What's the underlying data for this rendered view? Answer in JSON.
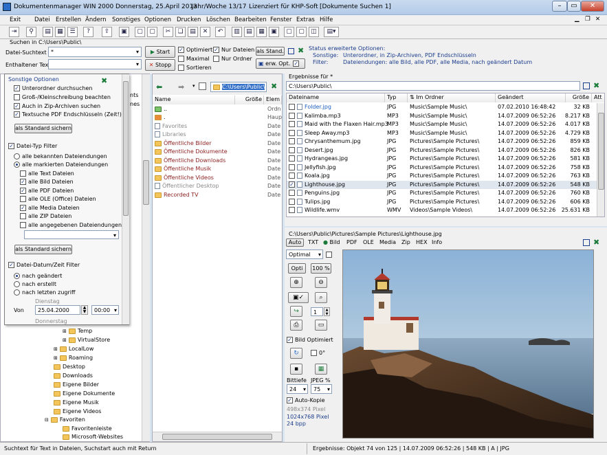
{
  "window": {
    "title": "Dokumentenmanager WIN 2000",
    "date": "Donnerstag, 25.April 2013",
    "week": "Jahr/Woche 13/17",
    "license": "Lizenziert für KHP-Soft",
    "doc": "[Dokumente Suchen 1]"
  },
  "menu": [
    "Exit",
    "Datei",
    "Erstellen",
    "Ändern",
    "Sonstiges",
    "Optionen",
    "Drucken",
    "Löschen",
    "Bearbeiten",
    "Fenster",
    "Extras",
    "Hilfe"
  ],
  "search": {
    "scope_label": "Suchen in C:\\Users\\Public\\",
    "file_label": "Datei-Suchtext",
    "file_value": "*",
    "content_label": "Enthaltener Text",
    "content_value": "",
    "start": "Start",
    "stop": "Stopp",
    "opt_optimiert": "Optimiert",
    "opt_maximal": "Maximal",
    "opt_sortieren": "Sortieren",
    "opt_nur_dateien": "Nur Dateien",
    "opt_nur_ordner": "Nur Ordner",
    "als_stand": "als Stand.",
    "erw_opt": "erw. Opt.",
    "status_title": "Status erweiterte Optionen:",
    "status_sonstige_k": "Sonstige:",
    "status_sonstige_v": "Unterordner, in Zip-Archiven, PDF Endschlüsseln",
    "status_filter_k": "Filter:",
    "status_filter_v": "Dateiendungen: alle Bild, alle PDF, alle Media, nach geändert Datum"
  },
  "options": {
    "title": "Sonstige Optionen",
    "items": [
      "Unterordner durchsuchen",
      "Groß-/Kleinschreibung beachten",
      "Auch in Zip-Archiven suchen",
      "Textsuche PDF Endschlüsseln (Zeit!)"
    ],
    "checked": [
      true,
      false,
      true,
      true
    ],
    "std_button": "als Standard sichern",
    "typ_title": "Datei-Typ Filter",
    "typ_radio": [
      "alle bekannten Dateiendungen",
      "alle markierten Dateiendungen"
    ],
    "typ_items": [
      "alle Text Dateien",
      "alle Bild Dateien",
      "alle PDF Dateien",
      "alle OLE (Office) Dateien",
      "alle Media Dateien",
      "alle ZIP Dateien",
      "alle angegebenen Dateiendungen"
    ],
    "typ_checked": [
      false,
      true,
      true,
      false,
      true,
      false,
      false
    ],
    "std_button2": "als Standard sichern",
    "date_title": "Datei-Datum/Zeit Filter",
    "date_radio": [
      "nach geändert",
      "nach erstellt",
      "nach letzten zugriff"
    ],
    "weekday": "Dienstag",
    "von_label": "Von",
    "von_date": "25.04.2000",
    "von_time": "00:00",
    "bis_weekday": "Donnerstag"
  },
  "tree_peek": [
    "nts",
    "nes"
  ],
  "tree": [
    "Temp",
    "VirtualStore",
    "LocalLow",
    "Roaming",
    "Desktop",
    "Downloads",
    "Eigene Bilder",
    "Eigene Dokumente",
    "Eigene Musik",
    "Eigene Videos",
    "Favoriten",
    "Favoritenleiste",
    "Microsoft-Websites"
  ],
  "browser": {
    "path": "C:\\Users\\Public\\",
    "cols": [
      "Name",
      "Größe",
      "Elem"
    ],
    "rows": [
      {
        "n": "..",
        "t": "Ordn"
      },
      {
        "n": ".",
        "t": "Haup"
      },
      {
        "n": "Favorites",
        "t": "Date"
      },
      {
        "n": "Libraries",
        "t": "Date"
      },
      {
        "n": "Öffentliche Bilder",
        "t": "Date"
      },
      {
        "n": "Öffentliche Dokumente",
        "t": "Date"
      },
      {
        "n": "Öffentliche Downloads",
        "t": "Date"
      },
      {
        "n": "Öffentliche Musik",
        "t": "Date"
      },
      {
        "n": "Öffentliche Videos",
        "t": "Date"
      },
      {
        "n": "Öffentlicher Desktop",
        "t": "Date"
      },
      {
        "n": "Recorded TV",
        "t": "Date"
      }
    ]
  },
  "results": {
    "label": "Ergebnisse für *",
    "path": "C:\\Users\\Public\\",
    "cols": [
      "Dateiname",
      "Typ",
      "Im Ordner",
      "Geändert",
      "Größe",
      "Att"
    ],
    "rows": [
      {
        "n": "Folder.jpg",
        "t": "JPG",
        "o": "Music\\Sample Music\\",
        "g": "07.02.2010 16:48:42",
        "s": "32 KB",
        "c": false
      },
      {
        "n": "Kalimba.mp3",
        "t": "MP3",
        "o": "Music\\Sample Music\\",
        "g": "14.07.2009 06:52:26",
        "s": "8.217 KB",
        "c": false
      },
      {
        "n": "Maid with the Flaxen Hair.mp3",
        "t": "MP3",
        "o": "Music\\Sample Music\\",
        "g": "14.07.2009 06:52:26",
        "s": "4.017 KB",
        "c": false
      },
      {
        "n": "Sleep Away.mp3",
        "t": "MP3",
        "o": "Music\\Sample Music\\",
        "g": "14.07.2009 06:52:26",
        "s": "4.729 KB",
        "c": false
      },
      {
        "n": "Chrysanthemum.jpg",
        "t": "JPG",
        "o": "Pictures\\Sample Pictures\\",
        "g": "14.07.2009 06:52:26",
        "s": "859 KB",
        "c": false
      },
      {
        "n": "Desert.jpg",
        "t": "JPG",
        "o": "Pictures\\Sample Pictures\\",
        "g": "14.07.2009 06:52:26",
        "s": "826 KB",
        "c": false
      },
      {
        "n": "Hydrangeas.jpg",
        "t": "JPG",
        "o": "Pictures\\Sample Pictures\\",
        "g": "14.07.2009 06:52:26",
        "s": "581 KB",
        "c": false
      },
      {
        "n": "Jellyfish.jpg",
        "t": "JPG",
        "o": "Pictures\\Sample Pictures\\",
        "g": "14.07.2009 06:52:26",
        "s": "758 KB",
        "c": false
      },
      {
        "n": "Koala.jpg",
        "t": "JPG",
        "o": "Pictures\\Sample Pictures\\",
        "g": "14.07.2009 06:52:26",
        "s": "763 KB",
        "c": false
      },
      {
        "n": "Lighthouse.jpg",
        "t": "JPG",
        "o": "Pictures\\Sample Pictures\\",
        "g": "14.07.2009 06:52:26",
        "s": "548 KB",
        "c": true
      },
      {
        "n": "Penguins.jpg",
        "t": "JPG",
        "o": "Pictures\\Sample Pictures\\",
        "g": "14.07.2009 06:52:26",
        "s": "760 KB",
        "c": false
      },
      {
        "n": "Tulips.jpg",
        "t": "JPG",
        "o": "Pictures\\Sample Pictures\\",
        "g": "14.07.2009 06:52:26",
        "s": "606 KB",
        "c": false
      },
      {
        "n": "Wildlife.wmv",
        "t": "WMV",
        "o": "Videos\\Sample Videos\\",
        "g": "14.07.2009 06:52:26",
        "s": "25.631 KB",
        "c": false
      }
    ]
  },
  "preview": {
    "path": "C:\\Users\\Public\\Pictures\\Sample Pictures\\Lighthouse.jpg",
    "tabs": [
      "Auto",
      "TXT",
      "Bild",
      "PDF",
      "OLE",
      "Media",
      "Zip",
      "HEX",
      "Info"
    ],
    "mode": "Optimal",
    "opti": "Opti",
    "zoom100": "100 %",
    "count": "1",
    "bild_opt": "Bild Optimiert",
    "rot": "0°",
    "bittiefe_label": "Bittiefe",
    "jpeg_label": "JPEG %",
    "bittiefe": "24",
    "jpeg": "75",
    "autokopie": "Auto-Kopie",
    "size1": "498x374 Pixel",
    "size2": "1024x768 Pixel",
    "bpp": "24 bpp"
  },
  "status": {
    "left": "Suchtext für Text in Dateien, Suchstart auch mit Return",
    "right": "Ergebnisse: Objekt 74 von 125 | 14.07.2009 06:52:26 | 548 KB | A | JPG"
  },
  "colors": {
    "accent": "#1a3c8c",
    "folder": "#f3c55b",
    "link_blue": "#1e5fbf",
    "red_folder": "#8b1d1d"
  }
}
